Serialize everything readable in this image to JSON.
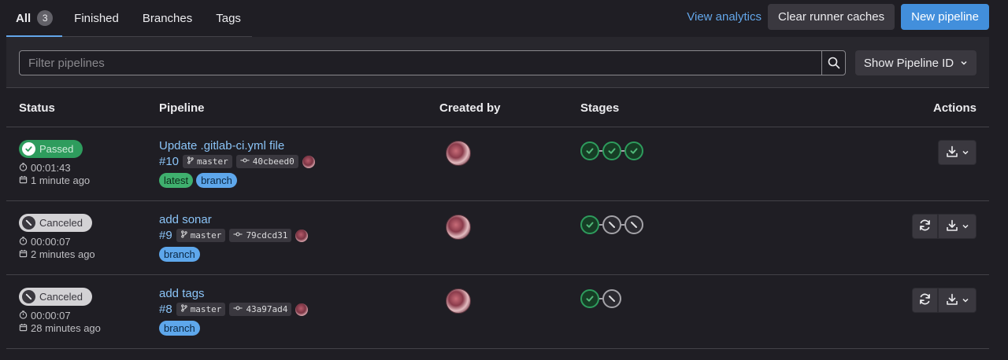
{
  "tabs": [
    {
      "label": "All",
      "count": "3"
    },
    {
      "label": "Finished"
    },
    {
      "label": "Branches"
    },
    {
      "label": "Tags"
    }
  ],
  "top_actions": {
    "analytics": "View analytics",
    "clear_caches": "Clear runner caches",
    "new_pipeline": "New pipeline"
  },
  "filter": {
    "placeholder": "Filter pipelines",
    "show_id": "Show Pipeline ID"
  },
  "columns": {
    "status": "Status",
    "pipeline": "Pipeline",
    "created_by": "Created by",
    "stages": "Stages",
    "actions": "Actions"
  },
  "pipelines": [
    {
      "status": "Passed",
      "duration": "00:01:43",
      "finished": "1 minute ago",
      "title": "Update .gitlab-ci.yml file",
      "id": "#10",
      "ref": "master",
      "commit": "40cbeed0",
      "tags": [
        "latest",
        "branch"
      ],
      "stages": [
        "success",
        "success",
        "success"
      ]
    },
    {
      "status": "Canceled",
      "duration": "00:00:07",
      "finished": "2 minutes ago",
      "title": "add sonar",
      "id": "#9",
      "ref": "master",
      "commit": "79cdcd31",
      "tags": [
        "branch"
      ],
      "stages": [
        "success",
        "canceled",
        "canceled"
      ]
    },
    {
      "status": "Canceled",
      "duration": "00:00:07",
      "finished": "28 minutes ago",
      "title": "add tags",
      "id": "#8",
      "ref": "master",
      "commit": "43a97ad4",
      "tags": [
        "branch"
      ],
      "stages": [
        "success",
        "canceled"
      ]
    }
  ],
  "colors": {
    "background": "#1f1e24",
    "link": "#8bc4f7",
    "success": "#2e9c5d",
    "primary": "#428fdc"
  }
}
